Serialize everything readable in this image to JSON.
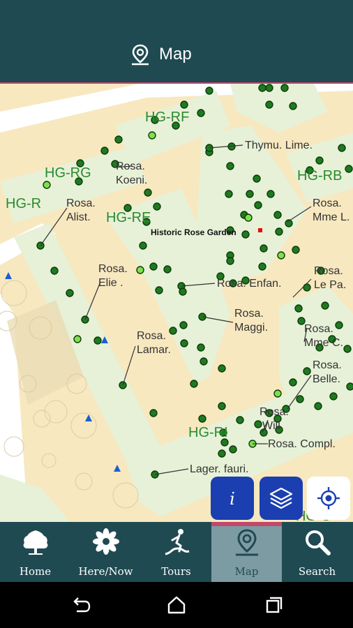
{
  "header": {
    "title": "Map",
    "icon": "map-pin-icon",
    "bg": "#1f4a52",
    "accent": "#c2476a"
  },
  "map": {
    "poi_label": "Historic Rose Garden",
    "beds": [
      {
        "label": "HG-RF"
      },
      {
        "label": "HG-RG"
      },
      {
        "label": "HG-R"
      },
      {
        "label": "HG-RE"
      },
      {
        "label": "HG-RB"
      },
      {
        "label": "HG-RI"
      }
    ],
    "plants": [
      {
        "label": "Thymu. Lime."
      },
      {
        "label": "Rosa.\nKoeni."
      },
      {
        "label": "Rosa.\nAlist."
      },
      {
        "label": "Rosa.\nMme L."
      },
      {
        "label": "Rosa.\nElie ."
      },
      {
        "label": "Rosa. Enfan."
      },
      {
        "label": "Rosa.\nLe Pa."
      },
      {
        "label": "Rosa.\nMaggi."
      },
      {
        "label": "Rosa.\nLamar."
      },
      {
        "label": "Rosa.\nMme C."
      },
      {
        "label": "Rosa.\nBelle."
      },
      {
        "label": "Rosa.\nWill"
      },
      {
        "label": "Rosa. Compl."
      },
      {
        "label": "Lager. fauri."
      }
    ],
    "partial_label": "HG-S",
    "colors": {
      "ground": "#f7e8c0",
      "bed": "#e7f1d8",
      "path": "#ffffff",
      "dot": "#1a7a1a",
      "dot_highlight": "#7fe04a",
      "bed_label": "#2c8a2c",
      "text": "#333333"
    }
  },
  "fabs": {
    "info": {
      "icon": "info-icon",
      "color": "#1b3fb0"
    },
    "layers": {
      "icon": "layers-icon",
      "color": "#1b3fb0"
    },
    "locate": {
      "icon": "locate-me-icon",
      "color": "#ffffff"
    }
  },
  "nav": {
    "tabs": [
      {
        "label": "Home",
        "icon": "tree-icon"
      },
      {
        "label": "Here/Now",
        "icon": "flower-icon"
      },
      {
        "label": "Tours",
        "icon": "walking-path-icon"
      },
      {
        "label": "Map",
        "icon": "map-pin-icon",
        "active": true
      },
      {
        "label": "Search",
        "icon": "search-icon"
      }
    ]
  },
  "system_nav": [
    {
      "icon": "back-icon"
    },
    {
      "icon": "home-circle-icon"
    },
    {
      "icon": "recents-icon"
    }
  ]
}
